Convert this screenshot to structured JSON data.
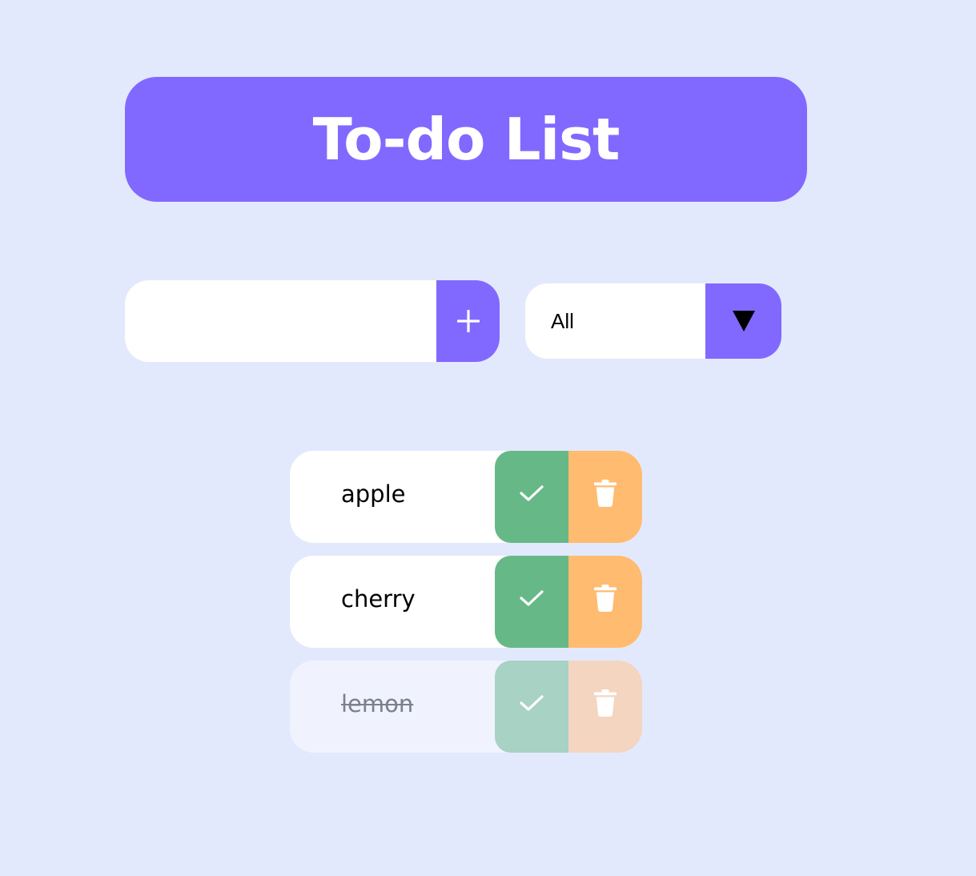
{
  "header": {
    "title": "To-do List"
  },
  "add_form": {
    "input_value": "",
    "add_button_icon": "plus-icon"
  },
  "filter": {
    "selected": "All",
    "arrow_icon": "triangle-down-icon"
  },
  "todos": [
    {
      "text": "apple",
      "completed": false,
      "check_icon": "checkmark-icon",
      "delete_icon": "trash-icon"
    },
    {
      "text": "cherry",
      "completed": false,
      "check_icon": "checkmark-icon",
      "delete_icon": "trash-icon"
    },
    {
      "text": "lemon",
      "completed": true,
      "check_icon": "checkmark-icon",
      "delete_icon": "trash-icon"
    }
  ],
  "colors": {
    "background": "#e3e9fc",
    "accent": "#8169ff",
    "check": "#66b986",
    "delete": "#ffbb70"
  }
}
